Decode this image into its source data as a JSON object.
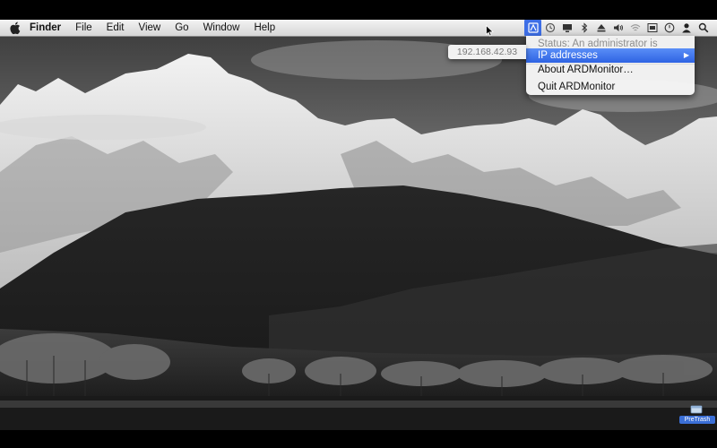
{
  "menubar": {
    "apple_icon": "apple-icon",
    "app_name": "Finder",
    "menus": [
      "File",
      "Edit",
      "View",
      "Go",
      "Window",
      "Help"
    ],
    "status_icons": [
      "ardmonitor-icon",
      "time-machine-icon",
      "display-icon",
      "bluetooth-icon",
      "eject-icon",
      "volume-icon",
      "wifi-icon",
      "keyboard-icon",
      "clock-icon",
      "user-icon",
      "spotlight-icon"
    ]
  },
  "ardmonitor_menu": {
    "status_text": "Status: An administrator is connected!",
    "ip_addresses_label": "IP addresses",
    "about_label": "About ARDMonitor…",
    "quit_label": "Quit ARDMonitor",
    "submenu": {
      "ip": "192.168.42.93"
    }
  },
  "desktop": {
    "pretrash_label": "PreTrash"
  },
  "colors": {
    "highlight": "#3d6ee6",
    "pretrash_label": "#3b6fd6"
  }
}
